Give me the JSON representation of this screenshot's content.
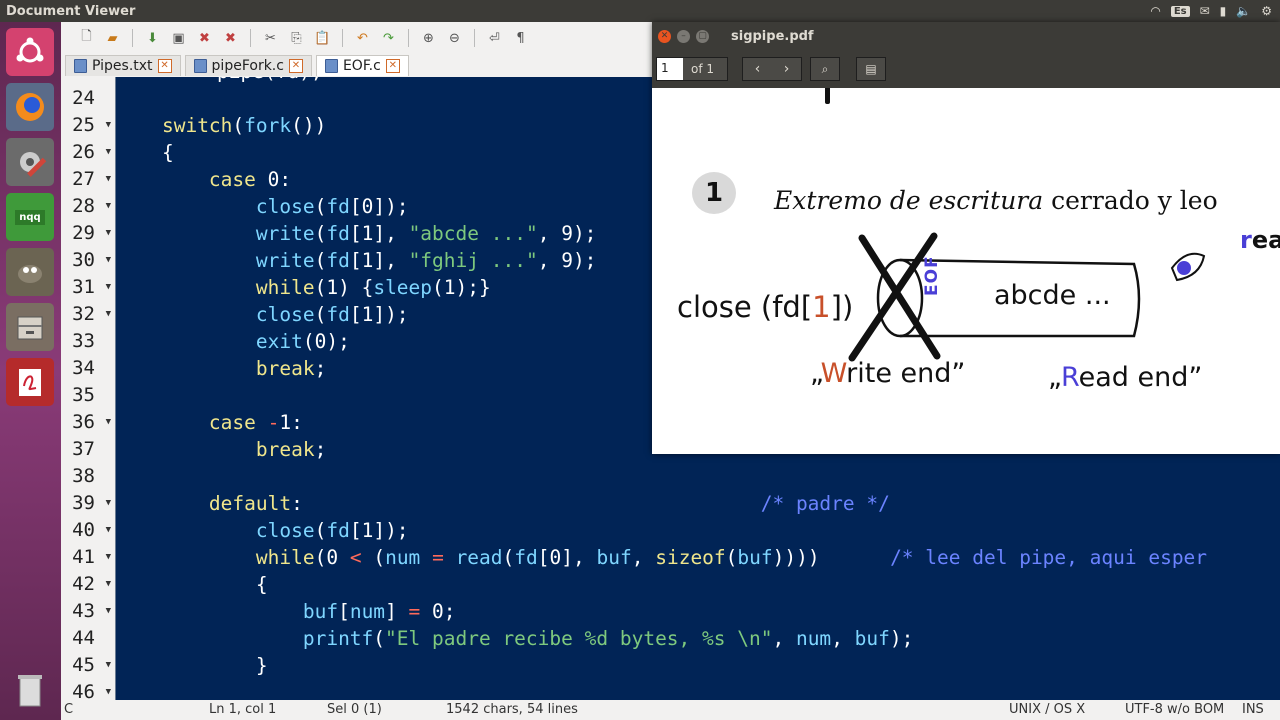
{
  "topbar": {
    "title": "Document Viewer",
    "keyboard": "Es"
  },
  "launcher": {
    "items": [
      "ubuntu-dash",
      "firefox",
      "settings",
      "nqq",
      "gimp",
      "files",
      "document-viewer",
      "trash"
    ],
    "nqq_label": "nqq"
  },
  "tabs": [
    {
      "label": "Pipes.txt"
    },
    {
      "label": "pipeFork.c"
    },
    {
      "label": "EOF.c",
      "active": true
    }
  ],
  "code": {
    "partial_top": "pipe(fd);",
    "lines": [
      {
        "n": "24",
        "fold": false,
        "tokens": []
      },
      {
        "n": "25",
        "fold": true,
        "tokens": [
          [
            "p",
            "    "
          ],
          [
            "kw",
            "switch"
          ],
          [
            "p",
            "("
          ],
          [
            "fn",
            "fork"
          ],
          [
            "p",
            "())"
          ]
        ]
      },
      {
        "n": "26",
        "fold": true,
        "tokens": [
          [
            "p",
            "    {"
          ]
        ]
      },
      {
        "n": "27",
        "fold": true,
        "tokens": [
          [
            "p",
            "        "
          ],
          [
            "kw",
            "case"
          ],
          [
            "p",
            " "
          ],
          [
            "num",
            "0"
          ],
          [
            "p",
            ":"
          ]
        ]
      },
      {
        "n": "28",
        "fold": true,
        "tokens": [
          [
            "p",
            "            "
          ],
          [
            "fn",
            "close"
          ],
          [
            "p",
            "("
          ],
          [
            "id",
            "fd"
          ],
          [
            "p",
            "["
          ],
          [
            "num",
            "0"
          ],
          [
            "p",
            "]);"
          ]
        ]
      },
      {
        "n": "29",
        "fold": true,
        "tokens": [
          [
            "p",
            "            "
          ],
          [
            "fn",
            "write"
          ],
          [
            "p",
            "("
          ],
          [
            "id",
            "fd"
          ],
          [
            "p",
            "["
          ],
          [
            "num",
            "1"
          ],
          [
            "p",
            "], "
          ],
          [
            "str",
            "\"abcde ...\""
          ],
          [
            "p",
            ", "
          ],
          [
            "num",
            "9"
          ],
          [
            "p",
            ");"
          ]
        ]
      },
      {
        "n": "30",
        "fold": true,
        "tokens": [
          [
            "p",
            "            "
          ],
          [
            "fn",
            "write"
          ],
          [
            "p",
            "("
          ],
          [
            "id",
            "fd"
          ],
          [
            "p",
            "["
          ],
          [
            "num",
            "1"
          ],
          [
            "p",
            "], "
          ],
          [
            "str",
            "\"fghij ...\""
          ],
          [
            "p",
            ", "
          ],
          [
            "num",
            "9"
          ],
          [
            "p",
            ");"
          ]
        ]
      },
      {
        "n": "31",
        "fold": true,
        "tokens": [
          [
            "p",
            "            "
          ],
          [
            "kw",
            "while"
          ],
          [
            "p",
            "("
          ],
          [
            "num",
            "1"
          ],
          [
            "p",
            ") {"
          ],
          [
            "fn",
            "sleep"
          ],
          [
            "p",
            "("
          ],
          [
            "num",
            "1"
          ],
          [
            "p",
            ");}"
          ]
        ]
      },
      {
        "n": "32",
        "fold": true,
        "tokens": [
          [
            "p",
            "            "
          ],
          [
            "fn",
            "close"
          ],
          [
            "p",
            "("
          ],
          [
            "id",
            "fd"
          ],
          [
            "p",
            "["
          ],
          [
            "num",
            "1"
          ],
          [
            "p",
            "]);"
          ]
        ]
      },
      {
        "n": "33",
        "fold": false,
        "tokens": [
          [
            "p",
            "            "
          ],
          [
            "fn",
            "exit"
          ],
          [
            "p",
            "("
          ],
          [
            "num",
            "0"
          ],
          [
            "p",
            ");"
          ]
        ]
      },
      {
        "n": "34",
        "fold": false,
        "tokens": [
          [
            "p",
            "            "
          ],
          [
            "kw",
            "break"
          ],
          [
            "p",
            ";"
          ]
        ]
      },
      {
        "n": "35",
        "fold": false,
        "tokens": []
      },
      {
        "n": "36",
        "fold": true,
        "tokens": [
          [
            "p",
            "        "
          ],
          [
            "kw",
            "case"
          ],
          [
            "p",
            " "
          ],
          [
            "op",
            "-"
          ],
          [
            "num",
            "1"
          ],
          [
            "p",
            ":"
          ]
        ]
      },
      {
        "n": "37",
        "fold": false,
        "tokens": [
          [
            "p",
            "            "
          ],
          [
            "kw",
            "break"
          ],
          [
            "p",
            ";"
          ]
        ]
      },
      {
        "n": "38",
        "fold": false,
        "tokens": []
      },
      {
        "n": "39",
        "fold": true,
        "tokens": [
          [
            "p",
            "        "
          ],
          [
            "kw",
            "default"
          ],
          [
            "p",
            ":                                       "
          ],
          [
            "cm",
            "/* padre */"
          ]
        ]
      },
      {
        "n": "40",
        "fold": true,
        "tokens": [
          [
            "p",
            "            "
          ],
          [
            "fn",
            "close"
          ],
          [
            "p",
            "("
          ],
          [
            "id",
            "fd"
          ],
          [
            "p",
            "["
          ],
          [
            "num",
            "1"
          ],
          [
            "p",
            "]);"
          ]
        ]
      },
      {
        "n": "41",
        "fold": true,
        "tokens": [
          [
            "p",
            "            "
          ],
          [
            "kw",
            "while"
          ],
          [
            "p",
            "("
          ],
          [
            "num",
            "0"
          ],
          [
            "p",
            " "
          ],
          [
            "op",
            "<"
          ],
          [
            "p",
            " ("
          ],
          [
            "id",
            "num"
          ],
          [
            "p",
            " "
          ],
          [
            "op",
            "="
          ],
          [
            "p",
            " "
          ],
          [
            "fn",
            "read"
          ],
          [
            "p",
            "("
          ],
          [
            "id",
            "fd"
          ],
          [
            "p",
            "["
          ],
          [
            "num",
            "0"
          ],
          [
            "p",
            "], "
          ],
          [
            "id",
            "buf"
          ],
          [
            "p",
            ", "
          ],
          [
            "kw",
            "sizeof"
          ],
          [
            "p",
            "("
          ],
          [
            "id",
            "buf"
          ],
          [
            "p",
            "))))      "
          ],
          [
            "cm",
            "/* lee del pipe, aqui esper"
          ]
        ]
      },
      {
        "n": "42",
        "fold": true,
        "tokens": [
          [
            "p",
            "            {"
          ]
        ]
      },
      {
        "n": "43",
        "fold": true,
        "tokens": [
          [
            "p",
            "                "
          ],
          [
            "id",
            "buf"
          ],
          [
            "p",
            "["
          ],
          [
            "id",
            "num"
          ],
          [
            "p",
            "] "
          ],
          [
            "op",
            "="
          ],
          [
            "p",
            " "
          ],
          [
            "num",
            "0"
          ],
          [
            "p",
            ";"
          ]
        ]
      },
      {
        "n": "44",
        "fold": false,
        "tokens": [
          [
            "p",
            "                "
          ],
          [
            "fn",
            "printf"
          ],
          [
            "p",
            "("
          ],
          [
            "str",
            "\"El padre recibe %d bytes, %s \\n\""
          ],
          [
            "p",
            ", "
          ],
          [
            "id",
            "num"
          ],
          [
            "p",
            ", "
          ],
          [
            "id",
            "buf"
          ],
          [
            "p",
            ");"
          ]
        ]
      },
      {
        "n": "45",
        "fold": true,
        "tokens": [
          [
            "p",
            "            }"
          ]
        ]
      },
      {
        "n": "46",
        "fold": true,
        "tokens": []
      }
    ]
  },
  "statusbar": {
    "col0": "C",
    "pos": "Ln 1, col 1",
    "sel": "Sel 0 (1)",
    "chars": "1542 chars, 54 lines",
    "eol": "UNIX / OS X",
    "enc": "UTF-8 w/o BOM",
    "mode": "INS"
  },
  "pdf": {
    "title": "sigpipe.pdf",
    "page_input": "1",
    "page_of": "of 1",
    "heading_num": "1",
    "heading_italic": "Extremo de escritura",
    "heading_rest": " cerrado y leo",
    "close_text": "close (fd[",
    "close_idx": "1",
    "close_end": "])",
    "eof": "EOF",
    "pipe_text": "abcde ...",
    "write_end_open": "„",
    "write_end_w": "W",
    "write_end_rest": "rite end”",
    "read_end_open": "„",
    "read_end_r": "R",
    "read_end_rest": "ead end”",
    "side_r": "r",
    "side_rest": "ea"
  },
  "colors": {
    "code_bg": "#012456",
    "keyword": "#f0e68c",
    "function": "#7fd6ff",
    "string": "#7ec97e",
    "comment": "#6b83ff",
    "operator": "#ff6a5a",
    "hand_red": "#c8502a",
    "hand_blue": "#4a3fd6"
  }
}
